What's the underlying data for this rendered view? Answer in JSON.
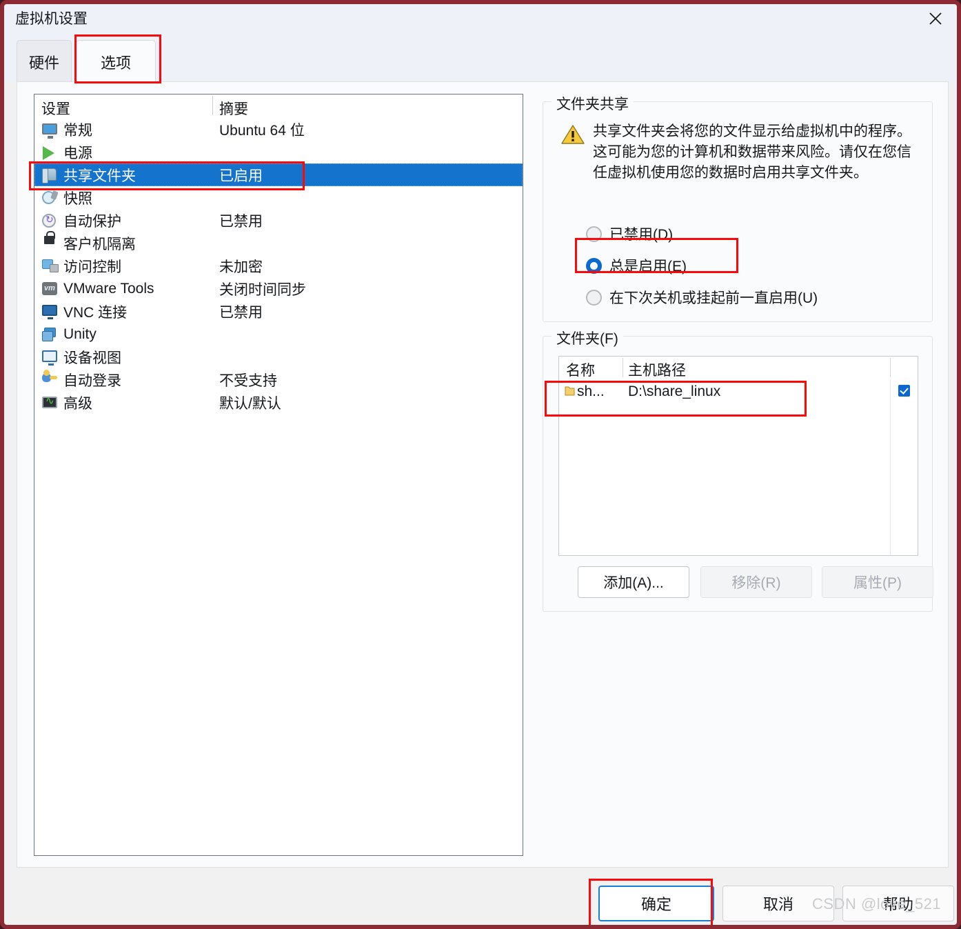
{
  "window": {
    "title": "虚拟机设置",
    "close_icon": "close-icon"
  },
  "tabs": [
    {
      "label": "硬件",
      "active": false
    },
    {
      "label": "选项",
      "active": true
    }
  ],
  "settings_list": {
    "columns": [
      "设置",
      "摘要"
    ],
    "rows": [
      {
        "icon": "monitor-icon",
        "label": "常规",
        "summary": "Ubuntu 64 位",
        "selected": false
      },
      {
        "icon": "play-icon",
        "label": "电源",
        "summary": "",
        "selected": false
      },
      {
        "icon": "shared-folder-icon",
        "label": "共享文件夹",
        "summary": "已启用",
        "selected": true
      },
      {
        "icon": "snapshot-icon",
        "label": "快照",
        "summary": "",
        "selected": false
      },
      {
        "icon": "autoprotect-icon",
        "label": "自动保护",
        "summary": "已禁用",
        "selected": false
      },
      {
        "icon": "lock-icon",
        "label": "客户机隔离",
        "summary": "",
        "selected": false
      },
      {
        "icon": "access-control-icon",
        "label": "访问控制",
        "summary": "未加密",
        "selected": false
      },
      {
        "icon": "vmware-tools-icon",
        "label": "VMware Tools",
        "summary": "关闭时间同步",
        "selected": false
      },
      {
        "icon": "vnc-icon",
        "label": "VNC 连接",
        "summary": "已禁用",
        "selected": false
      },
      {
        "icon": "unity-icon",
        "label": "Unity",
        "summary": "",
        "selected": false
      },
      {
        "icon": "device-view-icon",
        "label": "设备视图",
        "summary": "",
        "selected": false
      },
      {
        "icon": "autologin-icon",
        "label": "自动登录",
        "summary": "不受支持",
        "selected": false
      },
      {
        "icon": "advanced-icon",
        "label": "高级",
        "summary": "默认/默认",
        "selected": false
      }
    ]
  },
  "folder_sharing": {
    "group_title": "文件夹共享",
    "warning_icon": "warning-triangle-icon",
    "warning_text": "共享文件夹会将您的文件显示给虚拟机中的程序。这可能为您的计算机和数据带来风险。请仅在您信任虚拟机使用您的数据时启用共享文件夹。",
    "options": [
      {
        "label": "已禁用(D)",
        "selected": false
      },
      {
        "label": "总是启用(E)",
        "selected": true
      },
      {
        "label": "在下次关机或挂起前一直启用(U)",
        "selected": false
      }
    ]
  },
  "folders": {
    "group_title": "文件夹(F)",
    "columns": [
      "名称",
      "主机路径"
    ],
    "rows": [
      {
        "icon": "folder-icon",
        "name": "sh...",
        "path": "D:\\share_linux",
        "enabled": true
      }
    ],
    "buttons": [
      {
        "label": "添加(A)...",
        "enabled": true
      },
      {
        "label": "移除(R)",
        "enabled": false
      },
      {
        "label": "属性(P)",
        "enabled": false
      }
    ]
  },
  "dialog_buttons": [
    {
      "label": "确定",
      "default": true
    },
    {
      "label": "取消",
      "default": false
    },
    {
      "label": "帮助",
      "default": false
    }
  ],
  "watermark": "CSDN @love_521",
  "colors": {
    "selection_blue": "#1473cd",
    "accent_blue": "#0a68d0",
    "annotation_red": "#fb0808",
    "window_border": "#8e2a33",
    "warning_yellow": "#f5c518"
  }
}
